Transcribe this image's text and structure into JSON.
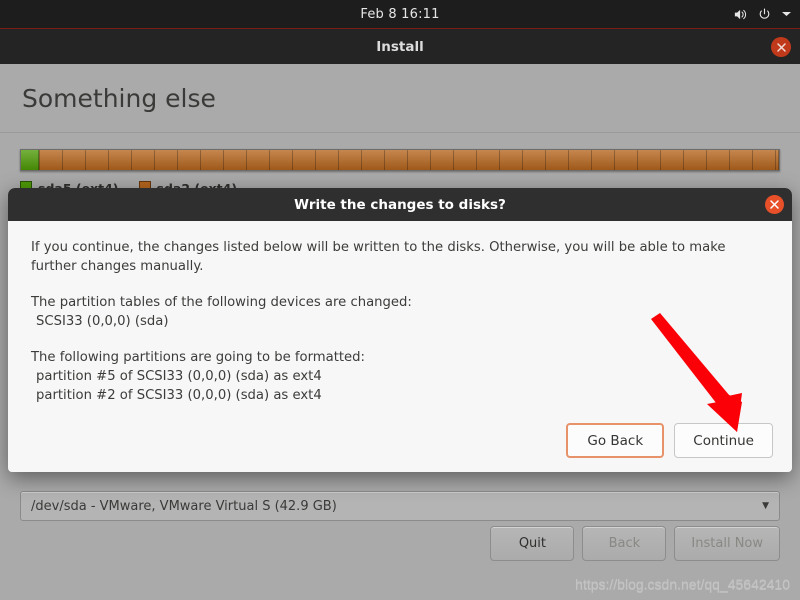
{
  "topbar": {
    "clock": "Feb 8  16:11",
    "icons": [
      "volume-icon",
      "power-icon",
      "chevron-down-icon"
    ]
  },
  "window": {
    "title": "Install",
    "close_icon": "close-icon",
    "page_title": "Something else"
  },
  "partitions": {
    "bar": [
      {
        "label": "sda5 (ext4)",
        "size": "1.0 GB",
        "color": "#4e9a06",
        "percent": 2.4
      },
      {
        "label": "sda2 (ext4)",
        "size": "41.9 GB",
        "color": "#b5651d",
        "percent": 97.6
      }
    ]
  },
  "device_combo": {
    "value": "/dev/sda - VMware, VMware Virtual S (42.9 GB)",
    "arrow_icon": "chevron-down-icon"
  },
  "footer": {
    "buttons": [
      {
        "label": "Quit",
        "disabled": false
      },
      {
        "label": "Back",
        "disabled": true
      },
      {
        "label": "Install Now",
        "disabled": true
      }
    ]
  },
  "dialog": {
    "title": "Write the changes to disks?",
    "close_icon": "close-icon",
    "paragraph_intro": "If you continue, the changes listed below will be written to the disks. Otherwise, you will be able to make further changes manually.",
    "heading_tables": "The partition tables of the following devices are changed:",
    "device_line": "SCSI33 (0,0,0) (sda)",
    "heading_format": "The following partitions are going to be formatted:",
    "format_line_1": "partition #5 of SCSI33 (0,0,0) (sda) as ext4",
    "format_line_2": "partition #2 of SCSI33 (0,0,0) (sda) as ext4",
    "buttons": {
      "go_back": "Go Back",
      "continue": "Continue"
    }
  },
  "annotation": {
    "arrow_color": "#fb0007",
    "points_to": "continue-button"
  },
  "watermark": "https://blog.csdn.net/qq_45642410",
  "colors": {
    "accent_orange": "#e8502a",
    "focus_orange": "#e8926a",
    "window_bg": "#aaaaaa",
    "dialog_bg": "#f7f7f7",
    "titlebar_dark": "#242424",
    "partition_green": "#4e9a06",
    "partition_orange": "#b5651d"
  }
}
